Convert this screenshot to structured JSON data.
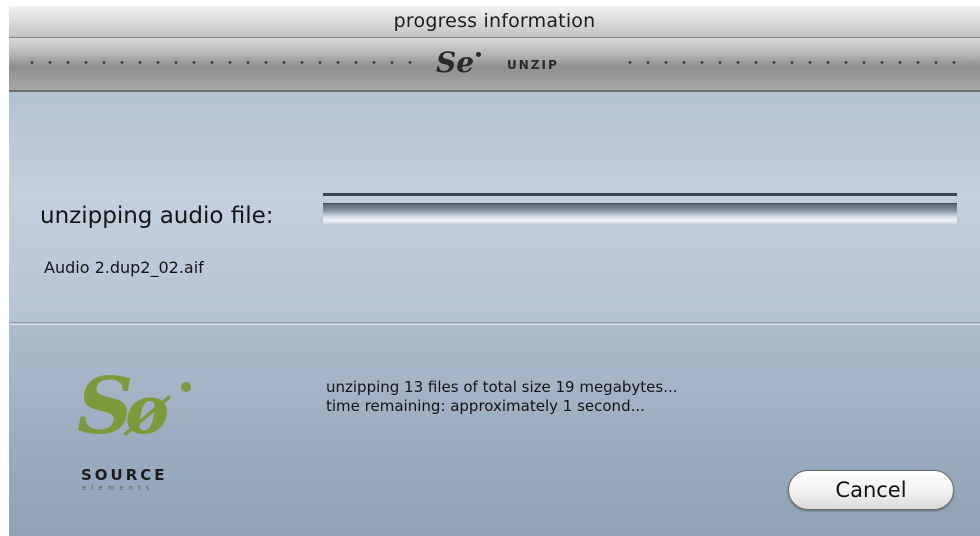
{
  "window": {
    "title": "progress information"
  },
  "toolbar": {
    "app_label": "UNZIP",
    "logo_icon": "source-elements-logo-icon"
  },
  "status": {
    "label": "unzipping audio file:",
    "filename": "Audio 2.dup2_02.aif"
  },
  "info": {
    "line1": "unzipping 13 files of total size 19 megabytes...",
    "line2": "time remaining: approximately 1 second..."
  },
  "brand": {
    "name": "SOURCE",
    "tagline": "elements",
    "green": "#7c9a3c"
  },
  "buttons": {
    "cancel": "Cancel"
  }
}
